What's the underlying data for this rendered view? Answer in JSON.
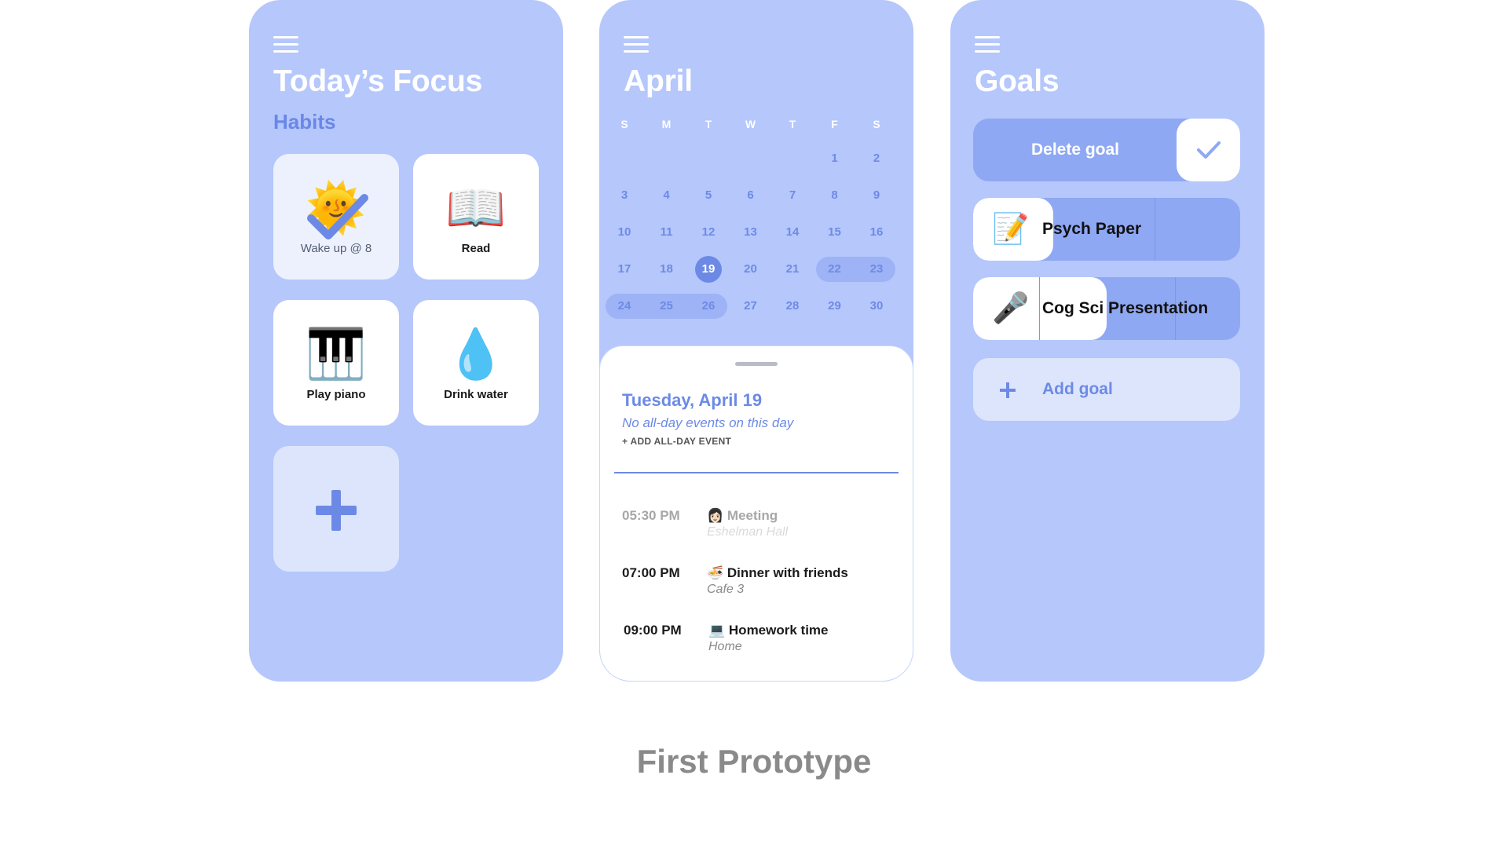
{
  "focus": {
    "title": "Today’s Focus",
    "subtitle": "Habits",
    "habits": [
      {
        "label": "Wake up @ 8",
        "icon": "🌞",
        "icon_name": "sun-icon",
        "done": true
      },
      {
        "label": "Read",
        "icon": "📖",
        "icon_name": "book-icon",
        "done": false
      },
      {
        "label": "Play piano",
        "icon": "🎹",
        "icon_name": "piano-icon",
        "done": false
      },
      {
        "label": "Drink water",
        "icon": "💧",
        "icon_name": "water-drop-icon",
        "done": false
      }
    ]
  },
  "calendar": {
    "month": "April",
    "weekdays": [
      "S",
      "M",
      "T",
      "W",
      "T",
      "F",
      "S"
    ],
    "days": [
      "1",
      "2",
      "3",
      "4",
      "5",
      "6",
      "7",
      "8",
      "9",
      "10",
      "11",
      "12",
      "13",
      "14",
      "15",
      "16",
      "17",
      "18",
      "19",
      "20",
      "21",
      "22",
      "23",
      "24",
      "25",
      "26",
      "27",
      "28",
      "29",
      "30"
    ],
    "first_weekday_index": 5,
    "selected_day": "19",
    "highlighted_days": [
      "22",
      "23",
      "24",
      "25",
      "26"
    ],
    "selected_date_label": "Tuesday, April 19",
    "no_events_note": "No all-day events on this day",
    "add_all_day_label": "+ ADD ALL-DAY EVENT",
    "events": [
      {
        "time": "05:30 PM",
        "icon": "👩🏻",
        "title": "Meeting",
        "location": "Eshelman Hall",
        "past": true
      },
      {
        "time": "07:00 PM",
        "icon": "🍜",
        "title": "Dinner with friends",
        "location": "Cafe 3",
        "past": false
      },
      {
        "time": "09:00 PM",
        "icon": "💻",
        "title": "Homework time",
        "location": "Home",
        "past": false
      }
    ]
  },
  "goals": {
    "title": "Goals",
    "delete_label": "Delete goal",
    "items": [
      {
        "label": "Psych Paper",
        "icon": "📝",
        "icon_name": "memo-icon",
        "progress": 0.3,
        "segments": 2
      },
      {
        "label": "Cog Sci Presentation",
        "icon": "🎤",
        "icon_name": "microphone-icon",
        "progress": 0.5,
        "segments": 3
      }
    ],
    "add_label": "Add goal"
  },
  "caption": "First Prototype",
  "colors": {
    "panel": "#b5c7fb",
    "accent": "#6c8ae5",
    "light": "#dde5fd"
  }
}
